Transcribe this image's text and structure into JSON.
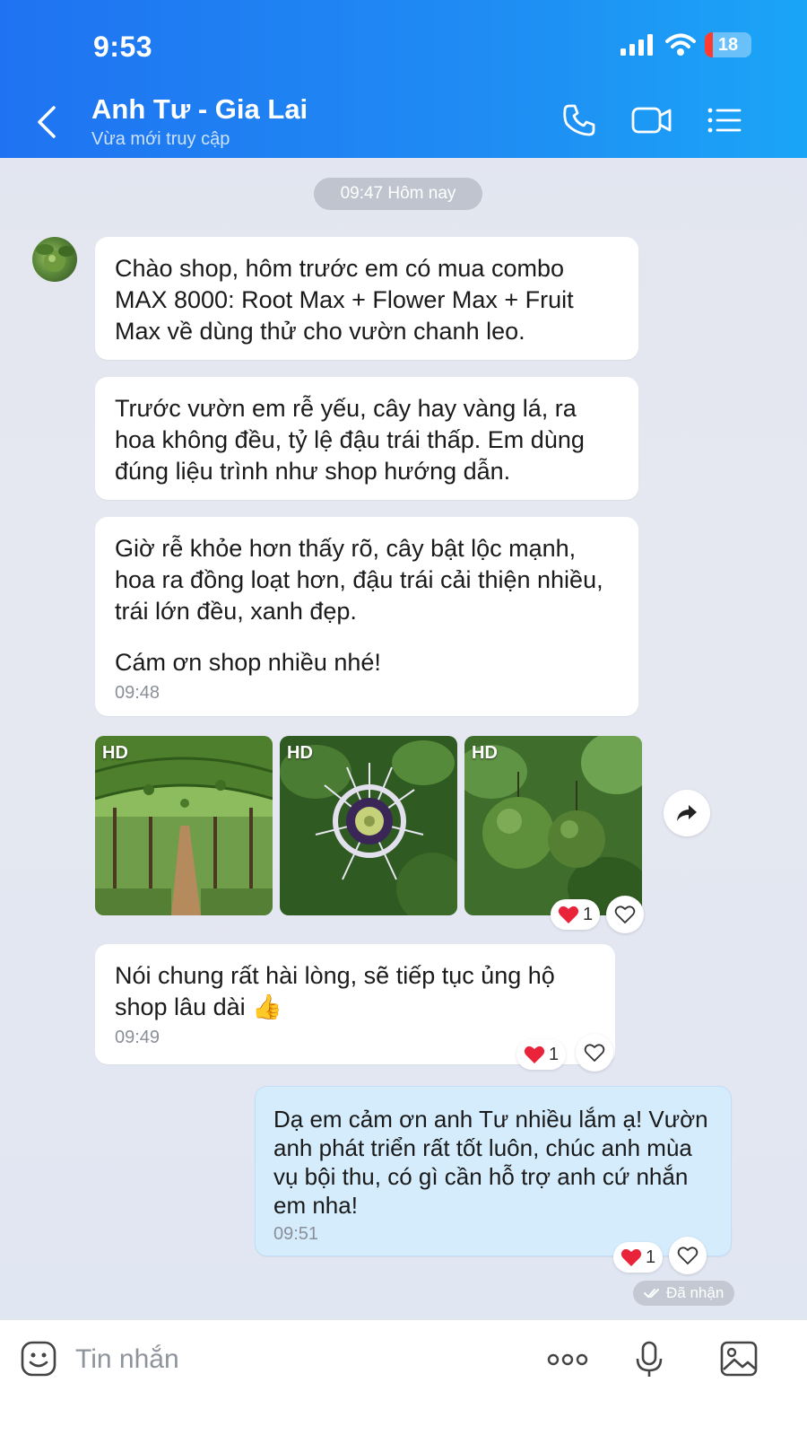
{
  "status_bar": {
    "time": "9:53",
    "battery": "18"
  },
  "header": {
    "contact_name": "Anh Tư - Gia Lai",
    "contact_status": "Vừa mới truy cập"
  },
  "chat": {
    "date_separator": "09:47 Hôm nay",
    "messages": [
      {
        "text": "Chào shop, hôm trước em có mua combo MAX 8000: Root Max + Flower Max + Fruit Max về dùng thử cho vườn chanh leo."
      },
      {
        "text": "Trước vườn em rễ yếu, cây hay vàng lá, ra hoa không đều, tỷ lệ đậu trái thấp. Em dùng đúng liệu trình như shop hướng dẫn."
      },
      {
        "text": "Giờ rễ khỏe hơn thấy rõ, cây bật lộc mạnh, hoa ra đồng loạt hơn, đậu trái cải thiện nhiều, trái lớn đều, xanh đẹp.",
        "text2": "Cám ơn shop nhiều nhé!",
        "time": "09:48"
      },
      {
        "text": "Nói chung rất hài lòng, sẽ tiếp tục ủng hộ shop lâu dài 👍",
        "time": "09:49",
        "reaction_count": "1"
      },
      {
        "text": "Dạ em cảm ơn anh Tư nhiều lắm ạ! Vườn anh phát triển rất tốt luôn, chúc anh mùa vụ bội thu, có gì cần hỗ trợ anh cứ nhắn em nha!",
        "time": "09:51",
        "reaction_count": "1"
      }
    ],
    "photos": [
      {
        "badge": "HD",
        "subject": "passion-fruit-trellis"
      },
      {
        "badge": "HD",
        "subject": "passion-flower"
      },
      {
        "badge": "HD",
        "subject": "passion-fruits"
      }
    ],
    "photos_reaction_count": "1",
    "delivery_status": "Đã nhận"
  },
  "input": {
    "placeholder": "Tin nhắn"
  },
  "colors": {
    "header_start": "#1f73f2",
    "header_end": "#1aa5f7",
    "my_bubble": "#d5ecfd",
    "heart": "#e8233a"
  }
}
